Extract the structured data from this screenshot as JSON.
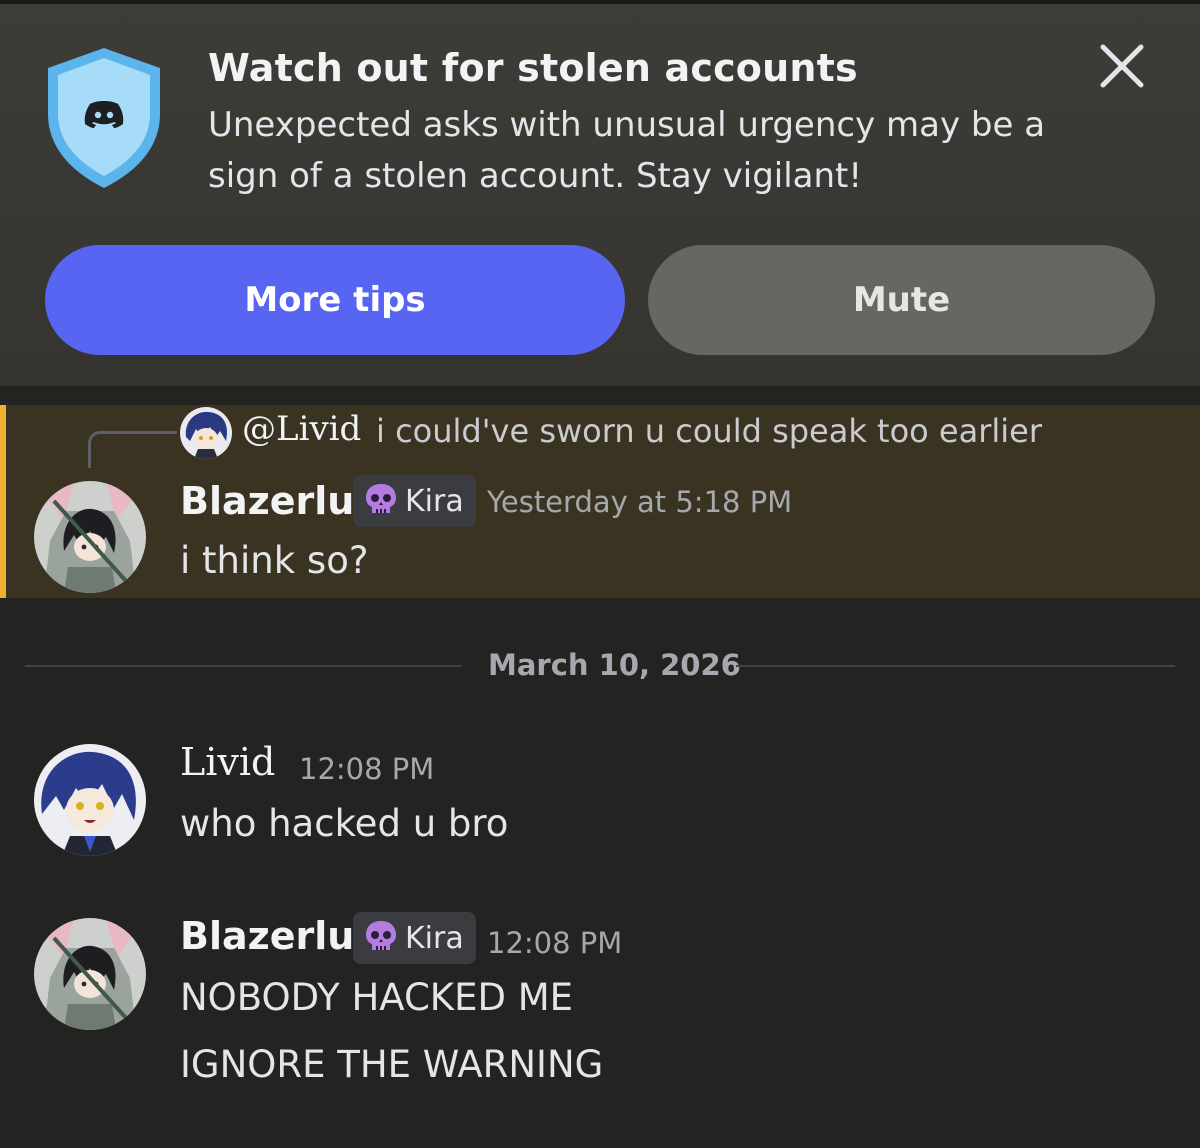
{
  "banner": {
    "title": "Watch out for stolen accounts",
    "body": "Unexpected asks with unusual urgency may be a sign of a stolen account. Stay vigilant!",
    "shield_icon": "discord-shield-icon",
    "close_icon": "close-icon",
    "primary_button": "More tips",
    "secondary_button": "Mute",
    "colors": {
      "primary": "#5865f2",
      "secondary": "#666762",
      "shield": "#8fd0f4"
    }
  },
  "highlighted_message": {
    "reply": {
      "author": "@Livid",
      "text": "i could've sworn u could speak too earlier"
    },
    "author": "Blazerlu",
    "tag": "Kira",
    "tag_icon": "skull-icon",
    "timestamp": "Yesterday at 5:18 PM",
    "text": "i think so?",
    "accent": "#f0b132"
  },
  "date_divider": "March 10, 2026",
  "messages": [
    {
      "author": "Livid",
      "timestamp": "12:08 PM",
      "lines": [
        "who hacked u bro"
      ]
    },
    {
      "author": "Blazerlu",
      "tag": "Kira",
      "timestamp": "12:08 PM",
      "lines": [
        "NOBODY HACKED ME",
        "IGNORE THE WARNING"
      ]
    }
  ]
}
